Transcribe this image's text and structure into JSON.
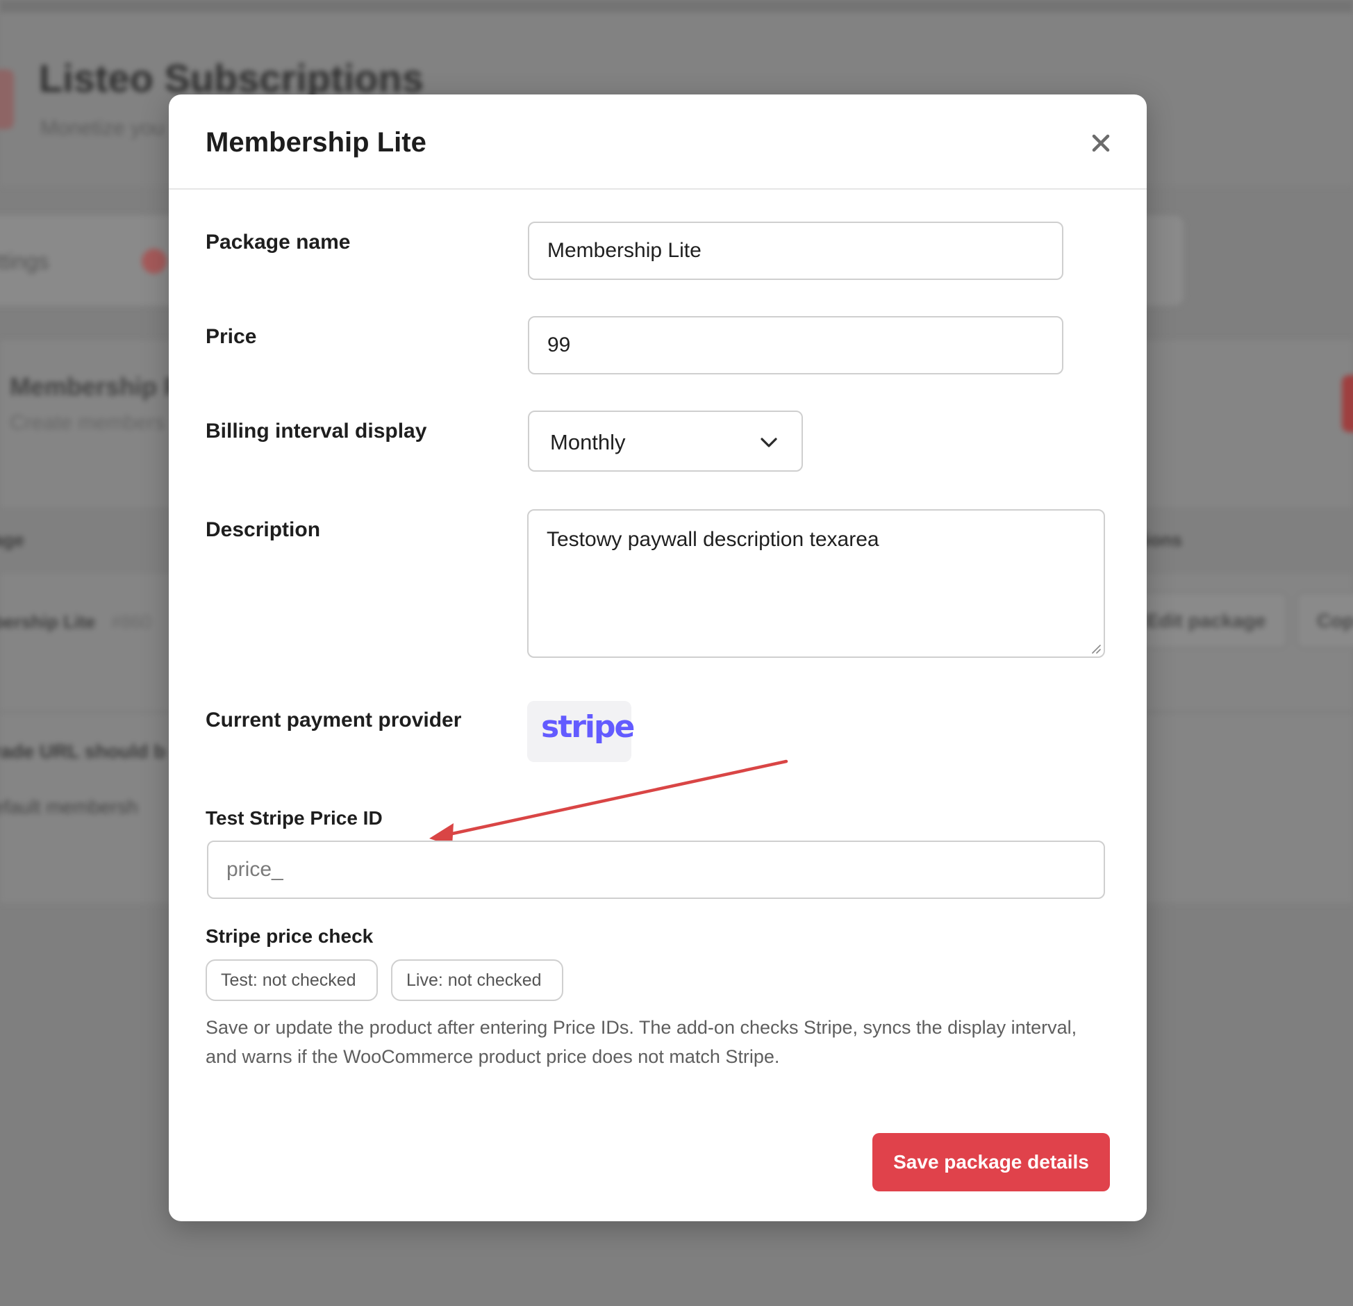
{
  "background": {
    "app_title": "Listeo Subscriptions",
    "app_subtitle": "Monetize you",
    "tab_settings": "ttings",
    "section_title": "Membership P",
    "section_subtitle": "Create members",
    "table_col_package": "age",
    "table_col_actions": "tions",
    "row_name": "bership Lite",
    "row_id": "#860",
    "edit_package_label": "Edit package",
    "copy_label": "Cop",
    "note_upgrade": "rade URL should b",
    "note_default": "efault membersh"
  },
  "modal": {
    "title": "Membership Lite",
    "close_icon": "close-icon",
    "fields": {
      "package_name": {
        "label": "Package name",
        "value": "Membership Lite"
      },
      "price": {
        "label": "Price",
        "value": "99"
      },
      "billing_interval": {
        "label": "Billing interval display",
        "value": "Monthly"
      },
      "description": {
        "label": "Description",
        "value": "Testowy paywall description texarea"
      },
      "payment_provider": {
        "label": "Current payment provider",
        "logo_text": "stripe",
        "logo_color": "#635bff"
      },
      "test_stripe_price_id": {
        "label": "Test Stripe Price ID",
        "value": "",
        "placeholder": "price_"
      }
    },
    "price_check": {
      "label": "Stripe price check",
      "test_status": "Test: not checked",
      "live_status": "Live: not checked"
    },
    "help_text": "Save or update the product after entering Price IDs. The add-on checks Stripe, syncs the display interval, and warns if the WooCommerce product price does not match Stripe.",
    "save_button": "Save package details"
  },
  "colors": {
    "accent": "#e0424b",
    "annotation_arrow": "#d94545",
    "overlay": "#7f7f7f"
  }
}
